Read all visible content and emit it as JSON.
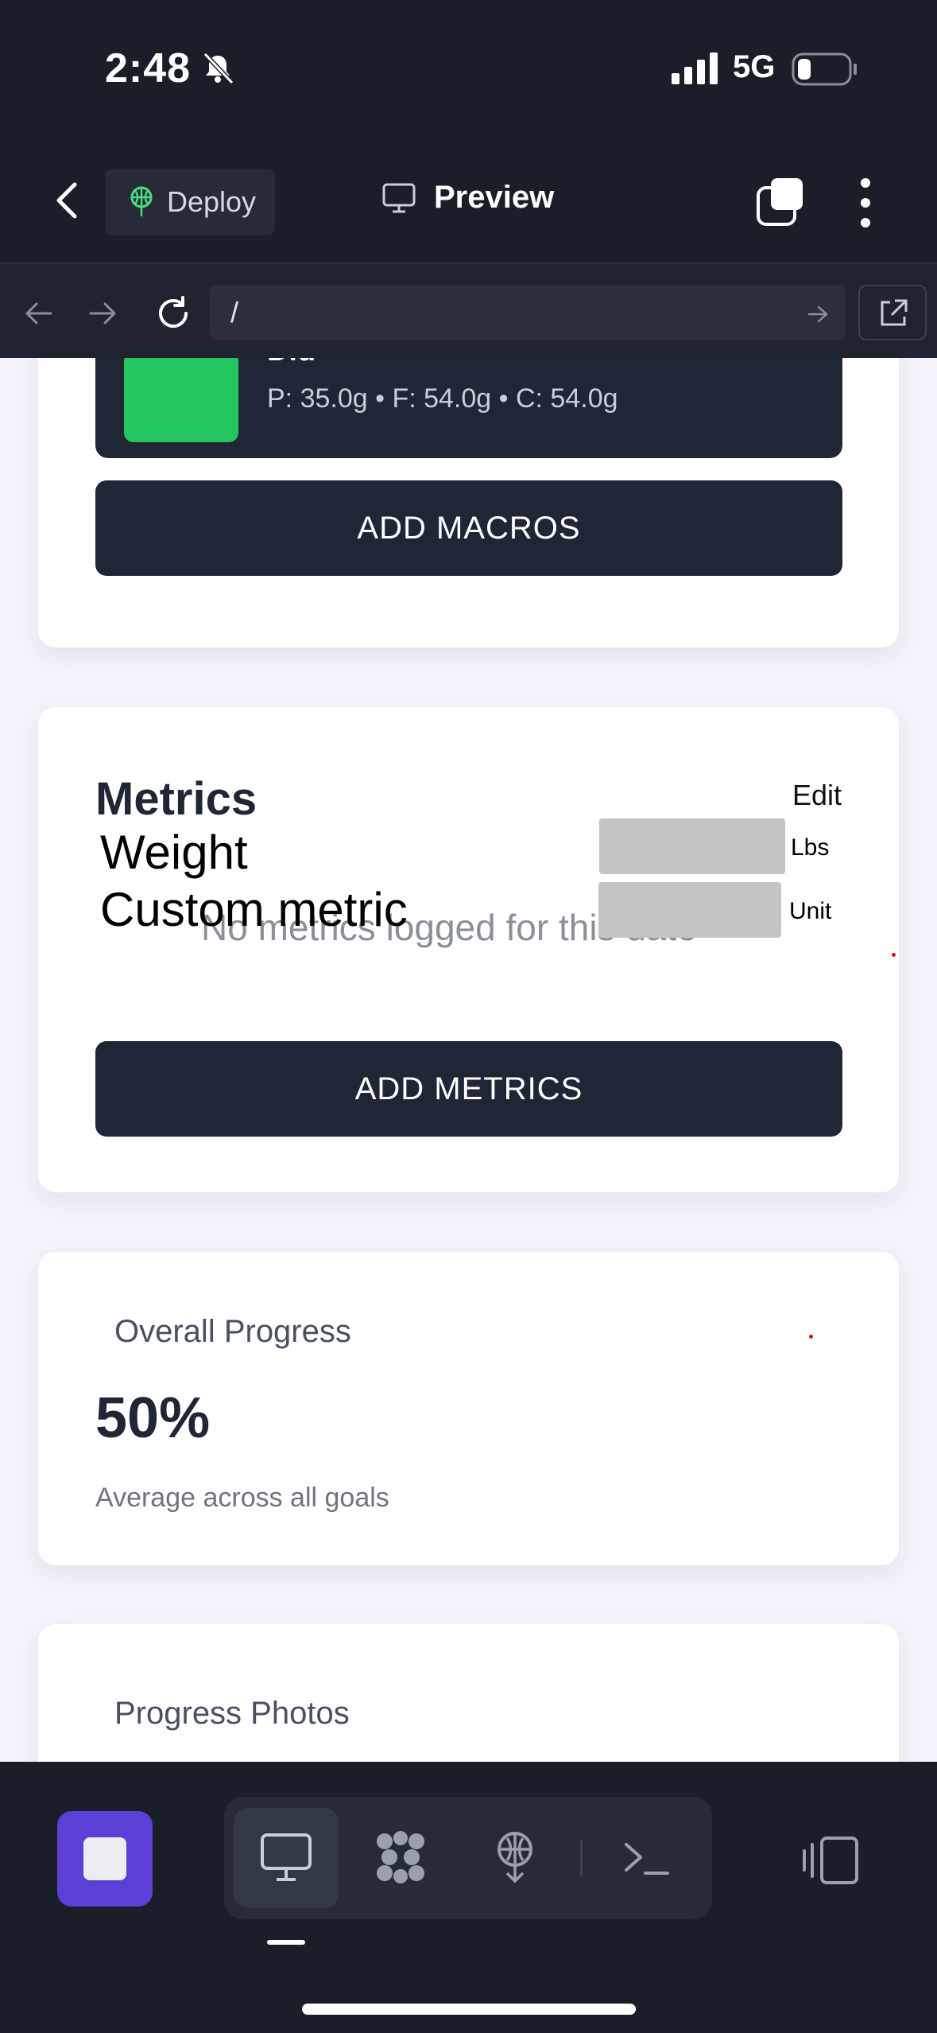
{
  "status_bar": {
    "time": "2:48",
    "network": "5G"
  },
  "header": {
    "deploy_label": "Deploy",
    "preview_label": "Preview"
  },
  "url_bar": {
    "url": "/"
  },
  "macros_card": {
    "food_name": "Did",
    "food_macros": "P: 35.0g • F: 54.0g • C: 54.0g",
    "add_button": "ADD MACROS"
  },
  "metrics_card": {
    "title": "Metrics",
    "edit_label": "Edit",
    "rows": [
      {
        "label": "Weight",
        "unit": "Lbs"
      },
      {
        "label": "Custom metric",
        "unit": "Unit"
      }
    ],
    "empty_message": "No metrics logged for this date",
    "add_button": "ADD METRICS"
  },
  "progress_card": {
    "title": "Overall Progress",
    "value": "50%",
    "subtitle": "Average across all goals"
  },
  "photos_card": {
    "title": "Progress Photos"
  },
  "colors": {
    "accent": "#5b3fd6",
    "thumb": "#23c55e",
    "dark": "#1f2636"
  }
}
